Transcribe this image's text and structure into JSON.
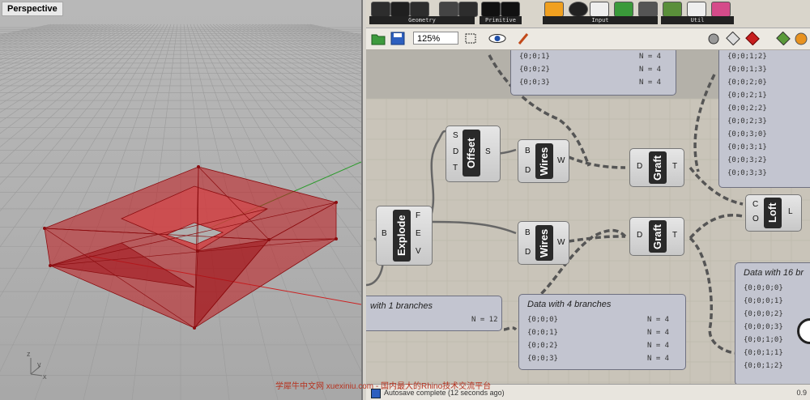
{
  "viewport": {
    "title": "Perspective",
    "axis_z": "z",
    "axis_y": "y",
    "axis_x": "x"
  },
  "ribbon": {
    "groups": [
      "Geometry",
      "Primitive",
      "Input",
      "Util"
    ]
  },
  "toolbar": {
    "zoom": "125%"
  },
  "components": {
    "offset": {
      "nick": "Offset",
      "inputs": [
        "S",
        "D",
        "T"
      ],
      "outputs": [
        "S"
      ]
    },
    "wires1": {
      "nick": "Wires",
      "inputs": [
        "B",
        "D"
      ],
      "outputs": [
        "W"
      ]
    },
    "wires2": {
      "nick": "Wires",
      "inputs": [
        "B",
        "D"
      ],
      "outputs": [
        "W"
      ]
    },
    "graft1": {
      "nick": "Graft",
      "inputs": [
        "D"
      ],
      "outputs": [
        "T"
      ]
    },
    "graft2": {
      "nick": "Graft",
      "inputs": [
        "D"
      ],
      "outputs": [
        "T"
      ]
    },
    "explode": {
      "nick": "Explode",
      "inputs": [
        "B"
      ],
      "outputs": [
        "F",
        "E",
        "V"
      ]
    },
    "loft": {
      "nick": "Loft",
      "inputs": [
        "C",
        "O"
      ],
      "outputs": [
        "L"
      ]
    }
  },
  "panels": {
    "top_left": {
      "rows": [
        [
          "{0;0;1}",
          "N = 4"
        ],
        [
          "{0;0;2}",
          "N = 4"
        ],
        [
          "{0;0;3}",
          "N = 4"
        ]
      ]
    },
    "top_right": {
      "rows": [
        "{0;0;1;2}",
        "{0;0;1;3}",
        "{0;0;2;0}",
        "{0;0;2;1}",
        "{0;0;2;2}",
        "{0;0;2;3}",
        "{0;0;3;0}",
        "{0;0;3;1}",
        "{0;0;3;2}",
        "{0;0;3;3}"
      ]
    },
    "one_branch": {
      "title": "with 1 branches",
      "count": "N = 12"
    },
    "four_branch": {
      "title": "Data with 4 branches",
      "rows": [
        [
          "{0;0;0}",
          "N = 4"
        ],
        [
          "{0;0;1}",
          "N = 4"
        ],
        [
          "{0;0;2}",
          "N = 4"
        ],
        [
          "{0;0;3}",
          "N = 4"
        ]
      ]
    },
    "sixteen_branch": {
      "title": "Data with 16 br",
      "rows": [
        "{0;0;0;0}",
        "{0;0;0;1}",
        "{0;0;0;2}",
        "{0;0;0;3}",
        "{0;0;1;0}",
        "{0;0;1;1}",
        "{0;0;1;2}"
      ]
    }
  },
  "status": {
    "text": "Autosave complete (12 seconds ago)",
    "right": "0.9"
  },
  "watermark": "学犀牛中文网 xuexiniu.com - 国内最大的Rhino技术交流平台",
  "colors": {
    "mesh": "#c0181c",
    "canvas": "#c9c4b9",
    "panel": "#c3c5d0"
  }
}
